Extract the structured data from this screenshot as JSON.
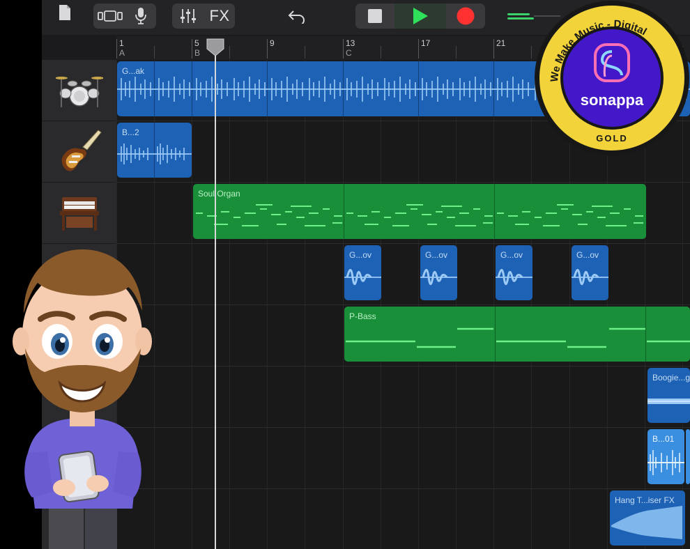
{
  "toolbar": {
    "fx_label": "FX",
    "buttons": [
      "document-icon",
      "tracks-view-icon",
      "microphone-icon",
      "mixer-icon",
      "fx-button",
      "undo-icon",
      "stop-icon",
      "play-icon",
      "record-icon",
      "volume-slider"
    ]
  },
  "ruler": {
    "bars": [
      {
        "num": "1",
        "section": "A"
      },
      {
        "num": "5",
        "section": "B"
      },
      {
        "num": "9",
        "section": ""
      },
      {
        "num": "13",
        "section": "C"
      },
      {
        "num": "17",
        "section": ""
      },
      {
        "num": "21",
        "section": ""
      }
    ]
  },
  "tracks": [
    {
      "instrument": "drum-kit",
      "regions": [
        {
          "label": "G...ak",
          "color": "blue"
        }
      ]
    },
    {
      "instrument": "electric-guitar",
      "regions": [
        {
          "label": "B...2",
          "color": "blue"
        }
      ]
    },
    {
      "instrument": "organ",
      "regions": [
        {
          "label": "Soul Organ",
          "color": "green"
        }
      ]
    },
    {
      "instrument": "audio",
      "regions": [
        {
          "label": "G...ov"
        },
        {
          "label": "G...ov"
        },
        {
          "label": "G...ov"
        },
        {
          "label": "G...ov"
        }
      ]
    },
    {
      "instrument": "bass",
      "regions": [
        {
          "label": "P-Bass",
          "color": "green"
        }
      ]
    },
    {
      "instrument": "audio",
      "regions": [
        {
          "label": "Boogie...g"
        }
      ]
    },
    {
      "instrument": "audio",
      "regions": [
        {
          "label": "B...01"
        }
      ]
    },
    {
      "instrument": "audio",
      "regions": [
        {
          "label": "Hang T...iser FX"
        }
      ]
    }
  ],
  "badge": {
    "top_text": "We Make Music - Digital",
    "brand": "sonappa",
    "tier": "GOLD"
  },
  "colors": {
    "region_blue": "#1d62b4",
    "region_light_blue": "#3a8fe0",
    "region_green": "#1a8f3a",
    "play": "#2ee05a",
    "record": "#ff3131",
    "badge_gold": "#f2d33a"
  }
}
